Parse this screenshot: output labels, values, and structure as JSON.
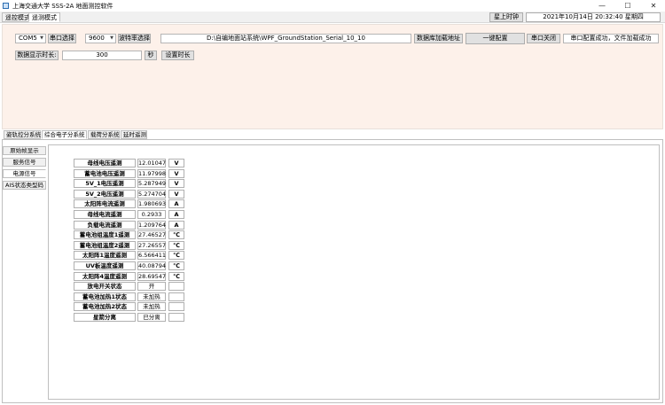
{
  "window": {
    "title": "上海交通大学 SSS-2A 地面测控软件",
    "minimize_glyph": "—",
    "maximize_glyph": "☐",
    "close_glyph": "✕"
  },
  "mode_tabs": [
    "遥控模式",
    "遥测模式"
  ],
  "topbar": {
    "time_button": "星上时钟",
    "datetime": "2021年10月14日  20:32:40  星期四"
  },
  "config": {
    "port_value": "COM5",
    "port_label": "串口选择",
    "baud_value": "9600",
    "baud_label": "波特率选择",
    "db_path": "D:\\自编地面站系统\\WPF_GroundStation_Serial_10_10",
    "db_button": "数据库加载地址",
    "one_key_button": "一键配置",
    "close_port_button": "串口关闭",
    "status_text": "串口配置成功，文件加载成功",
    "interval_label": "数据显示时长:",
    "interval_value": "300",
    "interval_unit": "秒",
    "set_interval_button": "设置时长"
  },
  "subsystem_tabs": [
    "姿轨控分系统",
    "综合电子分系统",
    "载荷分系统",
    "延时遥测"
  ],
  "vertical_tabs": [
    "原始帧显示",
    "服务信号",
    "电源信号",
    "AIS状态类型码"
  ],
  "power_rows": [
    {
      "label": "母线电压遥测",
      "value": "12.01047",
      "unit": "V"
    },
    {
      "label": "蓄电池电压遥测",
      "value": "11.97998",
      "unit": "V"
    },
    {
      "label": "5V_1电压遥测",
      "value": "5.287949",
      "unit": "V"
    },
    {
      "label": "5V_2电压遥测",
      "value": "5.274704",
      "unit": "V"
    },
    {
      "label": "太阳阵电流遥测",
      "value": "1.980693",
      "unit": "A"
    },
    {
      "label": "母线电流遥测",
      "value": "0.2933",
      "unit": "A"
    },
    {
      "label": "负载电流遥测",
      "value": "1.209764",
      "unit": "A"
    },
    {
      "label": "蓄电池组温度1遥测",
      "value": "27.46527",
      "unit": "℃"
    },
    {
      "label": "蓄电池组温度2遥测",
      "value": "27.26557",
      "unit": "℃"
    },
    {
      "label": "太阳阵1温度遥测",
      "value": "6.566411",
      "unit": "℃"
    },
    {
      "label": "UV板温度遥测",
      "value": "40.08794",
      "unit": "℃"
    },
    {
      "label": "太阳阵4温度遥测",
      "value": "28.69547",
      "unit": "℃"
    },
    {
      "label": "放电开关状态",
      "value": "开",
      "unit": ""
    },
    {
      "label": "蓄电池加热1状态",
      "value": "未加热",
      "unit": ""
    },
    {
      "label": "蓄电池加热2状态",
      "value": "未加热",
      "unit": ""
    },
    {
      "label": "星箭分离",
      "value": "已分离",
      "unit": ""
    }
  ]
}
